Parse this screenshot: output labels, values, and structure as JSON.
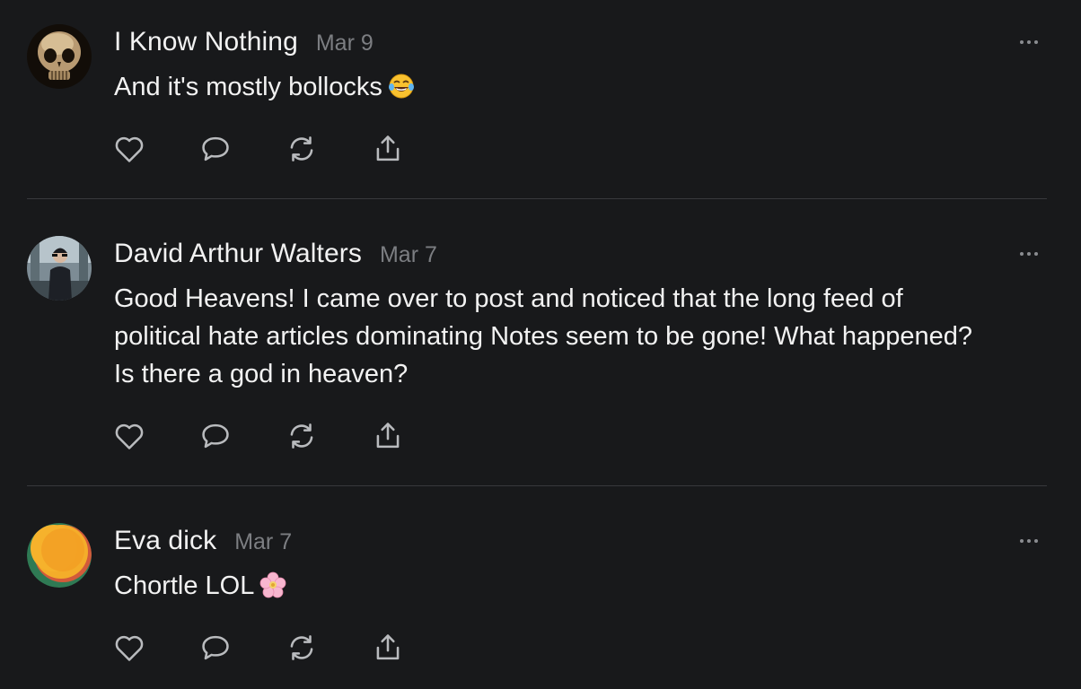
{
  "notes": [
    {
      "author": "I Know Nothing",
      "date": "Mar 9",
      "text": "And it's mostly bollocks",
      "emoji": "face-with-tears-of-joy-emoji",
      "avatar": "skull-avatar"
    },
    {
      "author": "David Arthur Walters",
      "date": "Mar 7",
      "text_lines": [
        "Good Heavens! I came over to post and noticed that the long feed of",
        "political hate articles dominating Notes seem to be gone! What happened?",
        "Is there a god in heaven?"
      ],
      "avatar": "person-photo-avatar"
    },
    {
      "author": "Eva dick",
      "date": "Mar 7",
      "text": "Chortle LOL",
      "emoji": "cherry-blossom-emoji",
      "avatar": "orange-circle-avatar"
    }
  ],
  "actions": [
    "heart-icon",
    "comment-icon",
    "restack-icon",
    "share-icon"
  ],
  "colors": {
    "background": "#18191b",
    "text": "#f2f2f2",
    "muted": "#7c7e82",
    "divider": "#38393c",
    "icon": "#b9bbbe"
  }
}
